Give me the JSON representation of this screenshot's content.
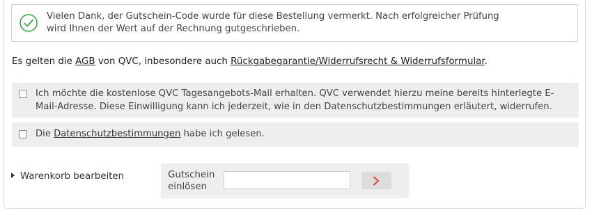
{
  "success_message": {
    "line1": "Vielen Dank, der Gutschein-Code wurde für diese Bestellung vermerkt. Nach erfolgreicher Prüfung",
    "line2": "wird Ihnen der Wert auf der Rechnung gutgeschrieben.",
    "icon": "check-circle-icon",
    "color": "#3aa64a"
  },
  "terms": {
    "prefix": "Es gelten die ",
    "agb_link": "AGB",
    "middle": " von QVC, inbesondere auch ",
    "return_link": "Rückgabegarantie/Widerrufsrecht & Widerrufsformular",
    "suffix": "."
  },
  "newsletter_option": {
    "line1": "Ich möchte die kostenlose QVC Tagesangebots-Mail erhalten. QVC verwendet hierzu meine bereits hinterlegte E-",
    "line2": "Mail-Adresse. Diese Einwilligung kann ich jederzeit, wie in den Datenschutzbestimmungen erläutert, widerrufen.",
    "checked": false
  },
  "privacy_option": {
    "prefix": "Die ",
    "link": "Datenschutzbestimmungen",
    "suffix": " habe ich gelesen.",
    "checked": false
  },
  "cart": {
    "edit_label": "Warenkorb bearbeiten"
  },
  "coupon": {
    "label_line1": "Gutschein",
    "label_line2": "einlösen",
    "input_value": "",
    "submit_icon": "chevron-right-icon",
    "submit_color": "#e0402f"
  }
}
